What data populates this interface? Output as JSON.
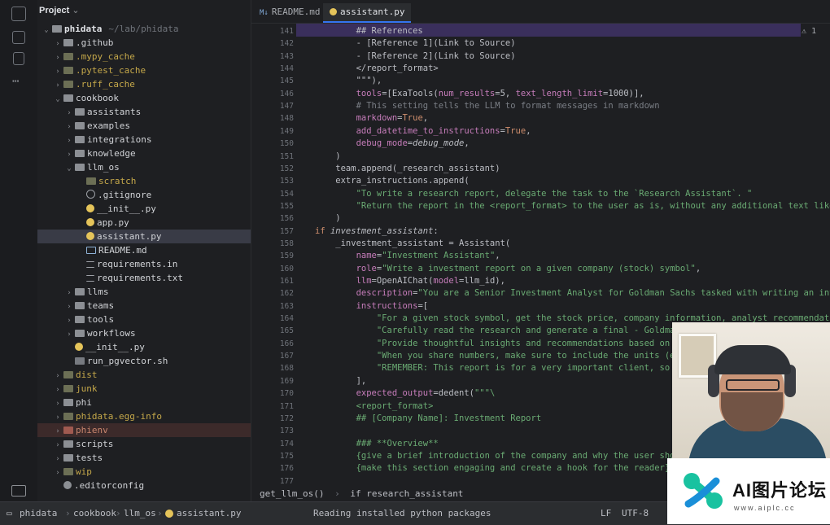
{
  "project_panel": {
    "title": "Project",
    "items": [
      {
        "label": "phidata",
        "path": "~/lab/phidata",
        "type": "folder",
        "indent": 0,
        "expanded": true,
        "style": "bold"
      },
      {
        "label": ".github",
        "type": "folder",
        "indent": 1,
        "expanded": false,
        "style": "normal"
      },
      {
        "label": ".mypy_cache",
        "type": "folder",
        "indent": 1,
        "expanded": false,
        "style": "ignored"
      },
      {
        "label": ".pytest_cache",
        "type": "folder",
        "indent": 1,
        "expanded": false,
        "style": "ignored"
      },
      {
        "label": ".ruff_cache",
        "type": "folder",
        "indent": 1,
        "expanded": false,
        "style": "ignored"
      },
      {
        "label": "cookbook",
        "type": "folder",
        "indent": 1,
        "expanded": true,
        "style": "normal"
      },
      {
        "label": "assistants",
        "type": "folder",
        "indent": 2,
        "expanded": false,
        "style": "normal"
      },
      {
        "label": "examples",
        "type": "folder",
        "indent": 2,
        "expanded": false,
        "style": "normal"
      },
      {
        "label": "integrations",
        "type": "folder",
        "indent": 2,
        "expanded": false,
        "style": "normal"
      },
      {
        "label": "knowledge",
        "type": "folder",
        "indent": 2,
        "expanded": false,
        "style": "normal"
      },
      {
        "label": "llm_os",
        "type": "folder",
        "indent": 2,
        "expanded": true,
        "style": "normal"
      },
      {
        "label": "scratch",
        "type": "folder",
        "indent": 3,
        "expanded": false,
        "style": "ignored",
        "nochev": true
      },
      {
        "label": ".gitignore",
        "type": "git",
        "indent": 3,
        "style": "normal"
      },
      {
        "label": "__init__.py",
        "type": "py",
        "indent": 3,
        "style": "normal"
      },
      {
        "label": "app.py",
        "type": "py",
        "indent": 3,
        "style": "normal"
      },
      {
        "label": "assistant.py",
        "type": "py",
        "indent": 3,
        "style": "normal",
        "selected": true
      },
      {
        "label": "README.md",
        "type": "md",
        "indent": 3,
        "style": "normal"
      },
      {
        "label": "requirements.in",
        "type": "txt",
        "indent": 3,
        "style": "normal"
      },
      {
        "label": "requirements.txt",
        "type": "txt",
        "indent": 3,
        "style": "normal"
      },
      {
        "label": "llms",
        "type": "folder",
        "indent": 2,
        "expanded": false,
        "style": "normal"
      },
      {
        "label": "teams",
        "type": "folder",
        "indent": 2,
        "expanded": false,
        "style": "normal"
      },
      {
        "label": "tools",
        "type": "folder",
        "indent": 2,
        "expanded": false,
        "style": "normal"
      },
      {
        "label": "workflows",
        "type": "folder",
        "indent": 2,
        "expanded": false,
        "style": "normal"
      },
      {
        "label": "__init__.py",
        "type": "py",
        "indent": 2,
        "style": "normal"
      },
      {
        "label": "run_pgvector.sh",
        "type": "sh",
        "indent": 2,
        "style": "normal"
      },
      {
        "label": "dist",
        "type": "folder",
        "indent": 1,
        "expanded": false,
        "style": "ignored"
      },
      {
        "label": "junk",
        "type": "folder",
        "indent": 1,
        "expanded": false,
        "style": "ignored"
      },
      {
        "label": "phi",
        "type": "folder",
        "indent": 1,
        "expanded": false,
        "style": "normal"
      },
      {
        "label": "phidata.egg-info",
        "type": "folder",
        "indent": 1,
        "expanded": false,
        "style": "ignored"
      },
      {
        "label": "phienv",
        "type": "folder",
        "indent": 1,
        "expanded": false,
        "style": "red"
      },
      {
        "label": "scripts",
        "type": "folder",
        "indent": 1,
        "expanded": false,
        "style": "normal"
      },
      {
        "label": "tests",
        "type": "folder",
        "indent": 1,
        "expanded": false,
        "style": "normal"
      },
      {
        "label": "wip",
        "type": "folder",
        "indent": 1,
        "expanded": false,
        "style": "ignored"
      },
      {
        "label": ".editorconfig",
        "type": "cfg",
        "indent": 1,
        "style": "normal"
      }
    ]
  },
  "tabs": [
    {
      "label": "README.md",
      "icon": "M↓",
      "active": false
    },
    {
      "label": "assistant.py",
      "icon": "py",
      "active": true
    }
  ],
  "inspection_widget": "1",
  "editor": {
    "lines": [
      {
        "n": "141",
        "tokens": [
          [
            "c-plain",
            "        ## References"
          ]
        ]
      },
      {
        "n": "142",
        "tokens": [
          [
            "c-plain",
            "        - [Reference 1](Link to Source)"
          ]
        ]
      },
      {
        "n": "143",
        "tokens": [
          [
            "c-plain",
            "        - [Reference 2](Link to Source)"
          ]
        ]
      },
      {
        "n": "144",
        "tokens": [
          [
            "c-plain",
            "        </report_format>"
          ]
        ]
      },
      {
        "n": "145",
        "tokens": [
          [
            "c-plain",
            "        \"\"\"),"
          ]
        ]
      },
      {
        "n": "146",
        "tokens": [
          [
            "c-param",
            "        tools"
          ],
          [
            "c-plain",
            "=[ExaTools("
          ],
          [
            "c-param",
            "num_results"
          ],
          [
            "c-plain",
            "=5, "
          ],
          [
            "c-param",
            "text_length_limit"
          ],
          [
            "c-plain",
            "=1000)],"
          ]
        ]
      },
      {
        "n": "147",
        "tokens": [
          [
            "c-cmt",
            "        # This setting tells the LLM to format messages in markdown"
          ]
        ]
      },
      {
        "n": "148",
        "tokens": [
          [
            "c-param",
            "        markdown"
          ],
          [
            "c-plain",
            "="
          ],
          [
            "c-bool",
            "True"
          ],
          [
            "c-plain",
            ","
          ]
        ]
      },
      {
        "n": "149",
        "tokens": [
          [
            "c-param",
            "        add_datetime_to_instructions"
          ],
          [
            "c-plain",
            "="
          ],
          [
            "c-bool",
            "True"
          ],
          [
            "c-plain",
            ","
          ]
        ]
      },
      {
        "n": "150",
        "tokens": [
          [
            "c-param",
            "        debug_mode"
          ],
          [
            "c-plain",
            "="
          ],
          [
            "c-ital",
            "debug_mode"
          ],
          [
            "c-plain",
            ","
          ]
        ]
      },
      {
        "n": "151",
        "tokens": [
          [
            "c-plain",
            "    )"
          ]
        ]
      },
      {
        "n": "152",
        "tokens": [
          [
            "c-plain",
            "    team.append(_research_assistant)"
          ]
        ]
      },
      {
        "n": "153",
        "tokens": [
          [
            "c-plain",
            "    extra_instructions.append("
          ]
        ]
      },
      {
        "n": "154",
        "tokens": [
          [
            "c-str",
            "        \"To write a research report, delegate the task to the `Research Assistant`. \""
          ]
        ]
      },
      {
        "n": "155",
        "tokens": [
          [
            "c-str",
            "        \"Return the report in the <report_format> to the user as is, without any additional text like 'here is the report'.\""
          ]
        ]
      },
      {
        "n": "156",
        "tokens": [
          [
            "c-plain",
            "    )"
          ]
        ]
      },
      {
        "n": "157",
        "tokens": [
          [
            "c-kw",
            "if "
          ],
          [
            "c-ital",
            "investment_assistant"
          ],
          [
            "c-plain",
            ":"
          ]
        ]
      },
      {
        "n": "158",
        "tokens": [
          [
            "c-plain",
            "    _investment_assistant = Assistant("
          ]
        ]
      },
      {
        "n": "159",
        "tokens": [
          [
            "c-param",
            "        name"
          ],
          [
            "c-plain",
            "="
          ],
          [
            "c-str",
            "\"Investment Assistant\""
          ],
          [
            "c-plain",
            ","
          ]
        ]
      },
      {
        "n": "160",
        "tokens": [
          [
            "c-param",
            "        role"
          ],
          [
            "c-plain",
            "="
          ],
          [
            "c-str",
            "\"Write a investment report on a given company (stock) symbol\""
          ],
          [
            "c-plain",
            ","
          ]
        ]
      },
      {
        "n": "161",
        "tokens": [
          [
            "c-param",
            "        llm"
          ],
          [
            "c-plain",
            "=OpenAIChat("
          ],
          [
            "c-param",
            "model"
          ],
          [
            "c-plain",
            "=llm_id),"
          ]
        ]
      },
      {
        "n": "162",
        "tokens": [
          [
            "c-param",
            "        description"
          ],
          [
            "c-plain",
            "="
          ],
          [
            "c-str",
            "\"You are a Senior Investment Analyst for Goldman Sachs tasked with writing an investment report\""
          ]
        ]
      },
      {
        "n": "163",
        "tokens": [
          [
            "c-param",
            "        instructions"
          ],
          [
            "c-plain",
            "=["
          ]
        ]
      },
      {
        "n": "164",
        "tokens": [
          [
            "c-str",
            "            \"For a given stock symbol, get the stock price, company information, analyst recommendations, and\""
          ]
        ]
      },
      {
        "n": "165",
        "tokens": [
          [
            "c-str",
            "            \"Carefully read the research and generate a final - Goldman Sachs worthy\""
          ]
        ]
      },
      {
        "n": "166",
        "tokens": [
          [
            "c-str",
            "            \"Provide thoughtful insights and recommendations based on the research\""
          ]
        ]
      },
      {
        "n": "167",
        "tokens": [
          [
            "c-str",
            "            \"When you share numbers, make sure to include the units (e.g., millions\""
          ]
        ]
      },
      {
        "n": "168",
        "tokens": [
          [
            "c-str",
            "            \"REMEMBER: This report is for a very important client, so the quality\""
          ]
        ]
      },
      {
        "n": "169",
        "tokens": [
          [
            "c-plain",
            "        ],"
          ]
        ]
      },
      {
        "n": "170",
        "tokens": [
          [
            "c-param",
            "        expected_output"
          ],
          [
            "c-plain",
            "=dedent("
          ],
          [
            "c-str",
            "\"\"\"\\"
          ]
        ]
      },
      {
        "n": "171",
        "tokens": [
          [
            "c-str",
            "        <report_format>"
          ]
        ]
      },
      {
        "n": "172",
        "tokens": [
          [
            "c-str",
            "        ## [Company Name]: Investment Report"
          ]
        ]
      },
      {
        "n": "173",
        "tokens": [
          [
            "c-str",
            ""
          ]
        ]
      },
      {
        "n": "174",
        "tokens": [
          [
            "c-str",
            "        ### **Overview**"
          ]
        ]
      },
      {
        "n": "175",
        "tokens": [
          [
            "c-str",
            "        {give a brief introduction of the company and why the user should read"
          ]
        ]
      },
      {
        "n": "176",
        "tokens": [
          [
            "c-str",
            "        {make this section engaging and create a hook for the reader}"
          ]
        ]
      },
      {
        "n": "177",
        "tokens": [
          [
            "c-str",
            ""
          ]
        ]
      }
    ]
  },
  "editor_breadcrumb": [
    "get_llm_os()",
    "if research_assistant"
  ],
  "statusbar": {
    "path": [
      "phidata",
      "cookbook",
      "llm_os",
      "assistant.py"
    ],
    "progress_text": "Reading installed python packages",
    "line_ending": "LF",
    "encoding": "UTF-8"
  },
  "watermark": {
    "title": "AI图片论坛",
    "url": "www.aiplc.cc"
  }
}
